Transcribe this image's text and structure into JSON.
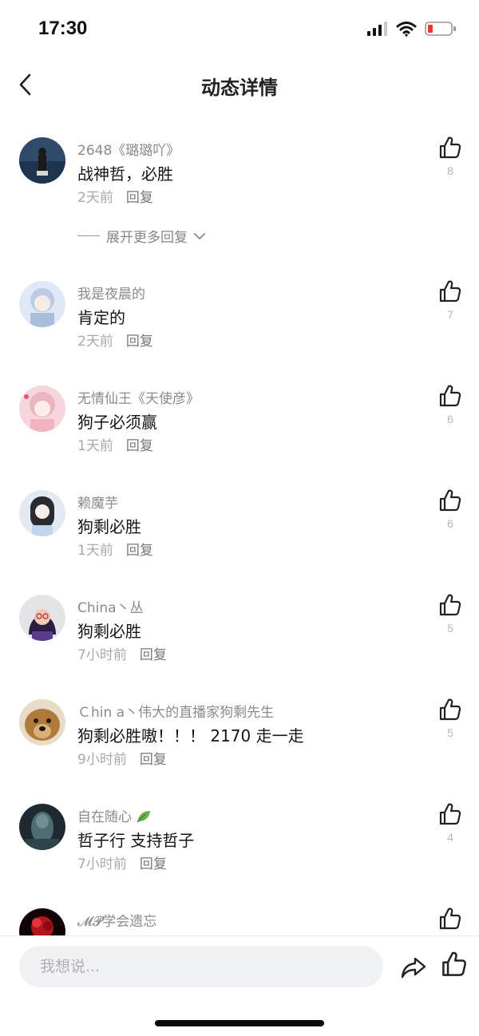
{
  "status_bar": {
    "time": "17:30"
  },
  "nav": {
    "title": "动态详情",
    "back_icon": "chevron-left-icon"
  },
  "expand": {
    "label": "展开更多回复"
  },
  "comments": [
    {
      "author": "2648《璐璐吖》",
      "text": "战神哲，必胜",
      "time": "2天前",
      "reply": "回复",
      "likes": "8"
    },
    {
      "author": "我是夜晨的",
      "text": "肯定的",
      "time": "2天前",
      "reply": "回复",
      "likes": "7"
    },
    {
      "author": "无情仙王《天使彦》",
      "text": "狗子必须赢",
      "time": "1天前",
      "reply": "回复",
      "likes": "6"
    },
    {
      "author": "赖魔芋",
      "text": "狗剩必胜",
      "time": "1天前",
      "reply": "回复",
      "likes": "6"
    },
    {
      "author": "China丶丛",
      "text": "狗剩必胜",
      "time": "7小时前",
      "reply": "回复",
      "likes": "5"
    },
    {
      "author": "Ｃhin a丶伟大的直播家狗剩先生",
      "text": "狗剩必胜嗷！！！ 2170 走一走",
      "time": "9小时前",
      "reply": "回复",
      "likes": "5"
    },
    {
      "author": "自在随心",
      "text": "哲子行 支持哲子",
      "time": "7小时前",
      "reply": "回复",
      "likes": "4"
    },
    {
      "author": "𝓜𝓟学会遗忘",
      "text": "",
      "time": "",
      "reply": "",
      "likes": ""
    }
  ],
  "bottom": {
    "input_placeholder": "我想说..."
  },
  "colors": {
    "text_primary": "#151515",
    "text_secondary": "#8a8a8f",
    "input_bg": "#f0f1f4",
    "battery_low": "#e53935"
  },
  "icons": [
    "thumbs-up-icon",
    "share-icon",
    "signal-icon",
    "wifi-icon",
    "battery-icon",
    "leaf-icon"
  ]
}
